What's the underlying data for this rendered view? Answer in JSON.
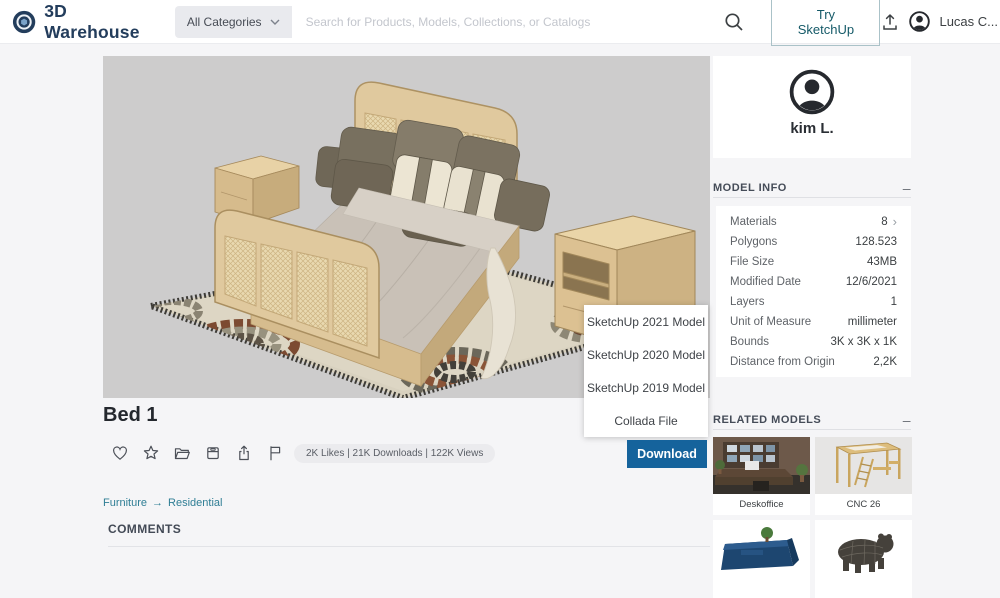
{
  "header": {
    "brand": "3D Warehouse",
    "categories_label": "All Categories",
    "search_placeholder": "Search for Products, Models, Collections, or Catalogs",
    "try_sketchup_label": "Try SketchUp",
    "username": "Lucas C..."
  },
  "model": {
    "title": "Bed 1",
    "stats": "2K Likes | 21K Downloads | 122K Views",
    "breadcrumb": [
      "Furniture",
      "Residential"
    ],
    "comments_header": "COMMENTS"
  },
  "download": {
    "button_label": "Download",
    "options": [
      "SketchUp 2021 Model",
      "SketchUp 2020 Model",
      "SketchUp 2019 Model",
      "Collada File"
    ]
  },
  "author": {
    "name": "kim L."
  },
  "model_info": {
    "header": "MODEL INFO",
    "rows": [
      {
        "label": "Materials",
        "value": "8",
        "has_chevron": true
      },
      {
        "label": "Polygons",
        "value": "128.523"
      },
      {
        "label": "File Size",
        "value": "43MB"
      },
      {
        "label": "Modified Date",
        "value": "12/6/2021"
      },
      {
        "label": "Layers",
        "value": "1"
      },
      {
        "label": "Unit of Measure",
        "value": "millimeter"
      },
      {
        "label": "Bounds",
        "value": "3K x 3K x 1K"
      },
      {
        "label": "Distance from Origin",
        "value": "2,2K"
      }
    ]
  },
  "related": {
    "header": "RELATED MODELS",
    "items": [
      {
        "name": "Deskoffice"
      },
      {
        "name": "CNC 26"
      },
      {
        "name": ""
      },
      {
        "name": ""
      }
    ]
  },
  "ui": {
    "collapse_glyph": "–",
    "materials_chevron": "›",
    "breadcrumb_separator": "→"
  },
  "icons": [
    "search-icon",
    "chevron-down-icon",
    "upload-icon",
    "avatar-icon",
    "heart-icon",
    "star-icon",
    "folder-icon",
    "archive-icon",
    "share-icon",
    "flag-icon",
    "chevron-right-icon",
    "minus-icon"
  ],
  "colors": {
    "download_blue": "#15639c",
    "brand_navy": "#233d5c",
    "link_teal": "#2f7e95",
    "viewer_bg": "#cdcccc"
  }
}
